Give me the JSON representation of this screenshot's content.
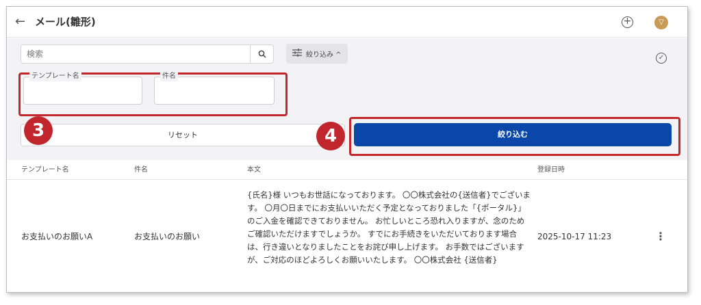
{
  "header": {
    "title": "メール(雛形)",
    "back_icon": "arrow-left-icon",
    "add_icon": "plus-circle-icon",
    "avatar_letter": "▽"
  },
  "filters": {
    "search_placeholder": "検索",
    "search_icon": "search-icon",
    "toggle_label": "絞り込み ^",
    "check_icon": "check-circle-icon",
    "template_name_label": "テンプレート名",
    "template_name_value": "",
    "subject_label": "件名",
    "subject_value": "",
    "reset_label": "リセット",
    "submit_label": "絞り込む"
  },
  "annotations": {
    "step_3": "3",
    "step_4": "4",
    "highlight_color": "#c1262d"
  },
  "table": {
    "columns": [
      "テンプレート名",
      "件名",
      "本文",
      "登録日時"
    ],
    "rows": [
      {
        "template_name": "お支払いのお願いA",
        "subject": "お支払いのお願い",
        "body": "{氏名}様 いつもお世話になっております。 〇〇株式会社の{送信者}でございます。 〇月〇日までにお支払いいただく予定となっておりました「{ポータル}」のご入金を確認できておりません。 お忙しいところ恐れ入りますが、念のためご確認いただけますでしょうか。 すでにお手続きをいただいております場合は、行き違いとなりましたことをお詫び申し上げます。 お手数ではございますが、ご対応のほどよろしくお願いいたします。 〇〇株式会社 {送信者}",
        "registered_at": "2025-10-17 11:23",
        "more_icon": "more-vertical-icon"
      }
    ]
  },
  "colors": {
    "primary": "#0a47a8",
    "filter_bg": "#f3f3f5",
    "avatar": "#c89a55"
  }
}
